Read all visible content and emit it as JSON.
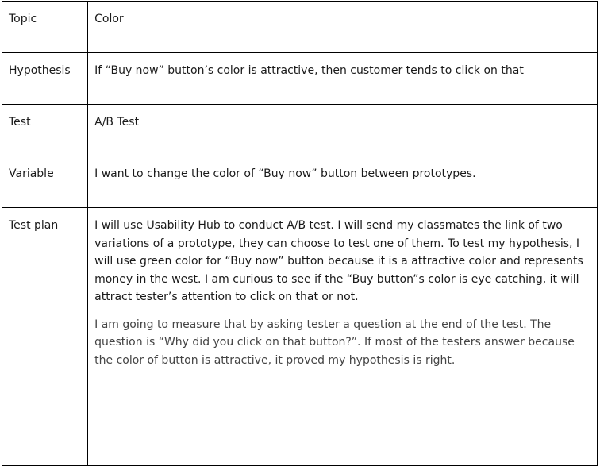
{
  "rows": [
    {
      "label": "Topic",
      "content": "Color"
    },
    {
      "label": "Hypothesis",
      "content": "If “Buy now” button’s color is attractive, then customer tends to click on that"
    },
    {
      "label": "Test",
      "content": "A/B Test"
    },
    {
      "label": "Variable",
      "content": "I want to change the color of  “Buy now” button between prototypes."
    },
    {
      "label": "Test plan",
      "paragraphs": [
        "I will use Usability Hub to conduct A/B test. I will send my classmates the link of two variations of a prototype, they can choose to test one of them. To test my hypothesis, I will use green color for “Buy now” button because it is a attractive color and represents money in the west. I am curious to see if the “Buy button”s color is eye catching, it will attract tester’s attention to click on that or not.",
        "I am going to measure that by asking tester a question at the end of the test. The question is “Why did you click on that button?”. If most of the testers answer because the color of button is attractive, it proved my hypothesis is right."
      ]
    }
  ]
}
